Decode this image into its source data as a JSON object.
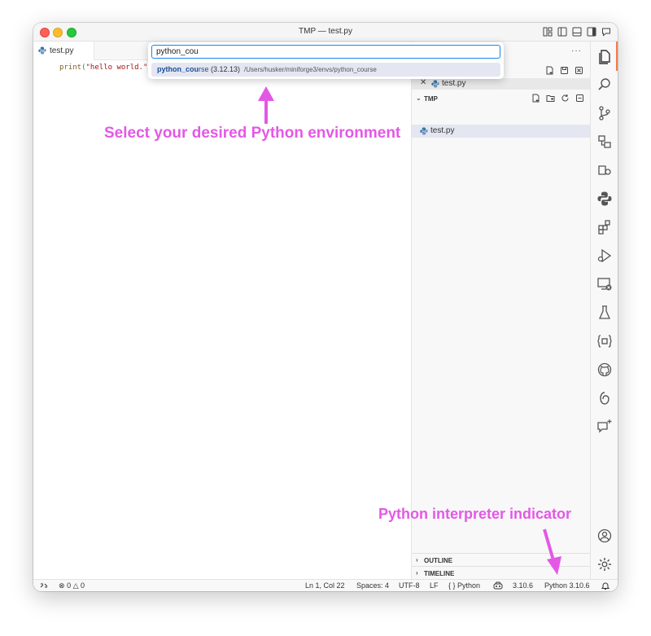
{
  "window": {
    "title": "TMP — test.py"
  },
  "editor": {
    "tab_label": "test.py",
    "code": {
      "fn": "print",
      "open": "(",
      "str": "\"hello world.\"",
      "close": ")"
    }
  },
  "palette": {
    "input_value": "python_cou",
    "item": {
      "match": "python_cou",
      "rest": "rse",
      "version": " (3.12.13)",
      "path": "/Users/husker/miniforge3/envs/python_course"
    }
  },
  "sidebar": {
    "more_label": "···",
    "open_editor_file": "test.py",
    "folder_name": "TMP",
    "file": "test.py",
    "outline_label": "OUTLINE",
    "timeline_label": "TIMELINE"
  },
  "statusbar": {
    "errors": "0",
    "warnings": "0",
    "position": "Ln 1, Col 22",
    "spaces": "Spaces: 4",
    "encoding": "UTF-8",
    "eol": "LF",
    "language_braces": "{ }",
    "language": "Python",
    "copilot_version": "3.10.6",
    "interpreter": "Python 3.10.6"
  },
  "annotations": {
    "select_env": "Select your desired Python environment",
    "interpreter_indicator": "Python interpreter indicator"
  },
  "colors": {
    "annotation": "#e458e6",
    "focus_border": "#1a85e5",
    "selection": "#e4e6f1",
    "activity_indicator": "#f27b53"
  },
  "icons": [
    "files-icon",
    "search-icon",
    "source-control-icon",
    "remote-explorer-icon",
    "extensions-remote-icon",
    "python-icon",
    "extensions-icon",
    "run-debug-icon",
    "remote-connection-icon",
    "testing-icon",
    "json-icon",
    "github-icon",
    "copilot-icon",
    "chat-icon",
    "account-icon",
    "settings-gear-icon"
  ]
}
